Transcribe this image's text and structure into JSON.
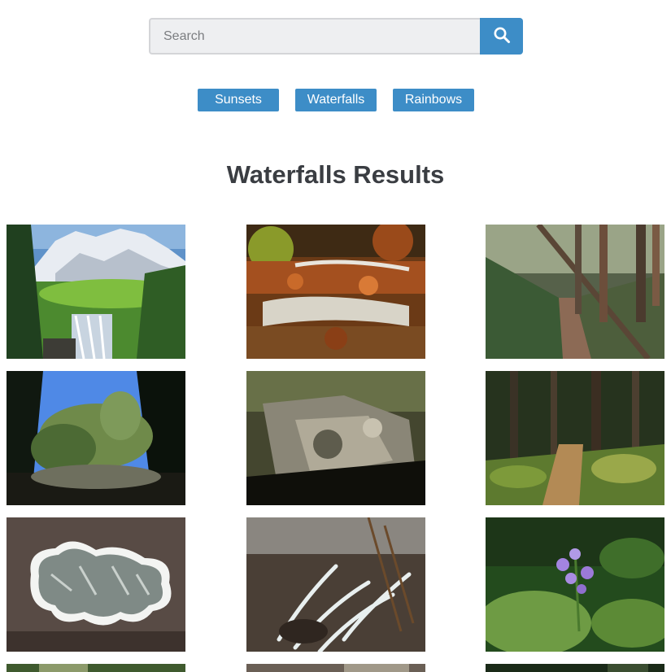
{
  "search": {
    "placeholder": "Search",
    "value": ""
  },
  "filters": [
    {
      "label": "Sunsets"
    },
    {
      "label": "Waterfalls"
    },
    {
      "label": "Rainbows"
    }
  ],
  "results": {
    "title": "Waterfalls Results",
    "images": [
      {
        "subject": "mountain-meadow-waterfall"
      },
      {
        "subject": "autumn-leaves-cascade"
      },
      {
        "subject": "forest-trail-fallen-logs"
      },
      {
        "subject": "trees-against-blue-sky"
      },
      {
        "subject": "mossy-rock-face"
      },
      {
        "subject": "sunlit-forest-trail"
      },
      {
        "subject": "lichen-on-rock"
      },
      {
        "subject": "white-lichen-and-twigs"
      },
      {
        "subject": "purple-wildflower"
      },
      {
        "subject": "partial-forest-image"
      },
      {
        "subject": "partial-rock-image"
      },
      {
        "subject": "partial-dark-forest-image"
      }
    ]
  },
  "colors": {
    "accent": "#3d8dc7",
    "title": "#3a3d42",
    "input_bg": "#eeeff1"
  }
}
